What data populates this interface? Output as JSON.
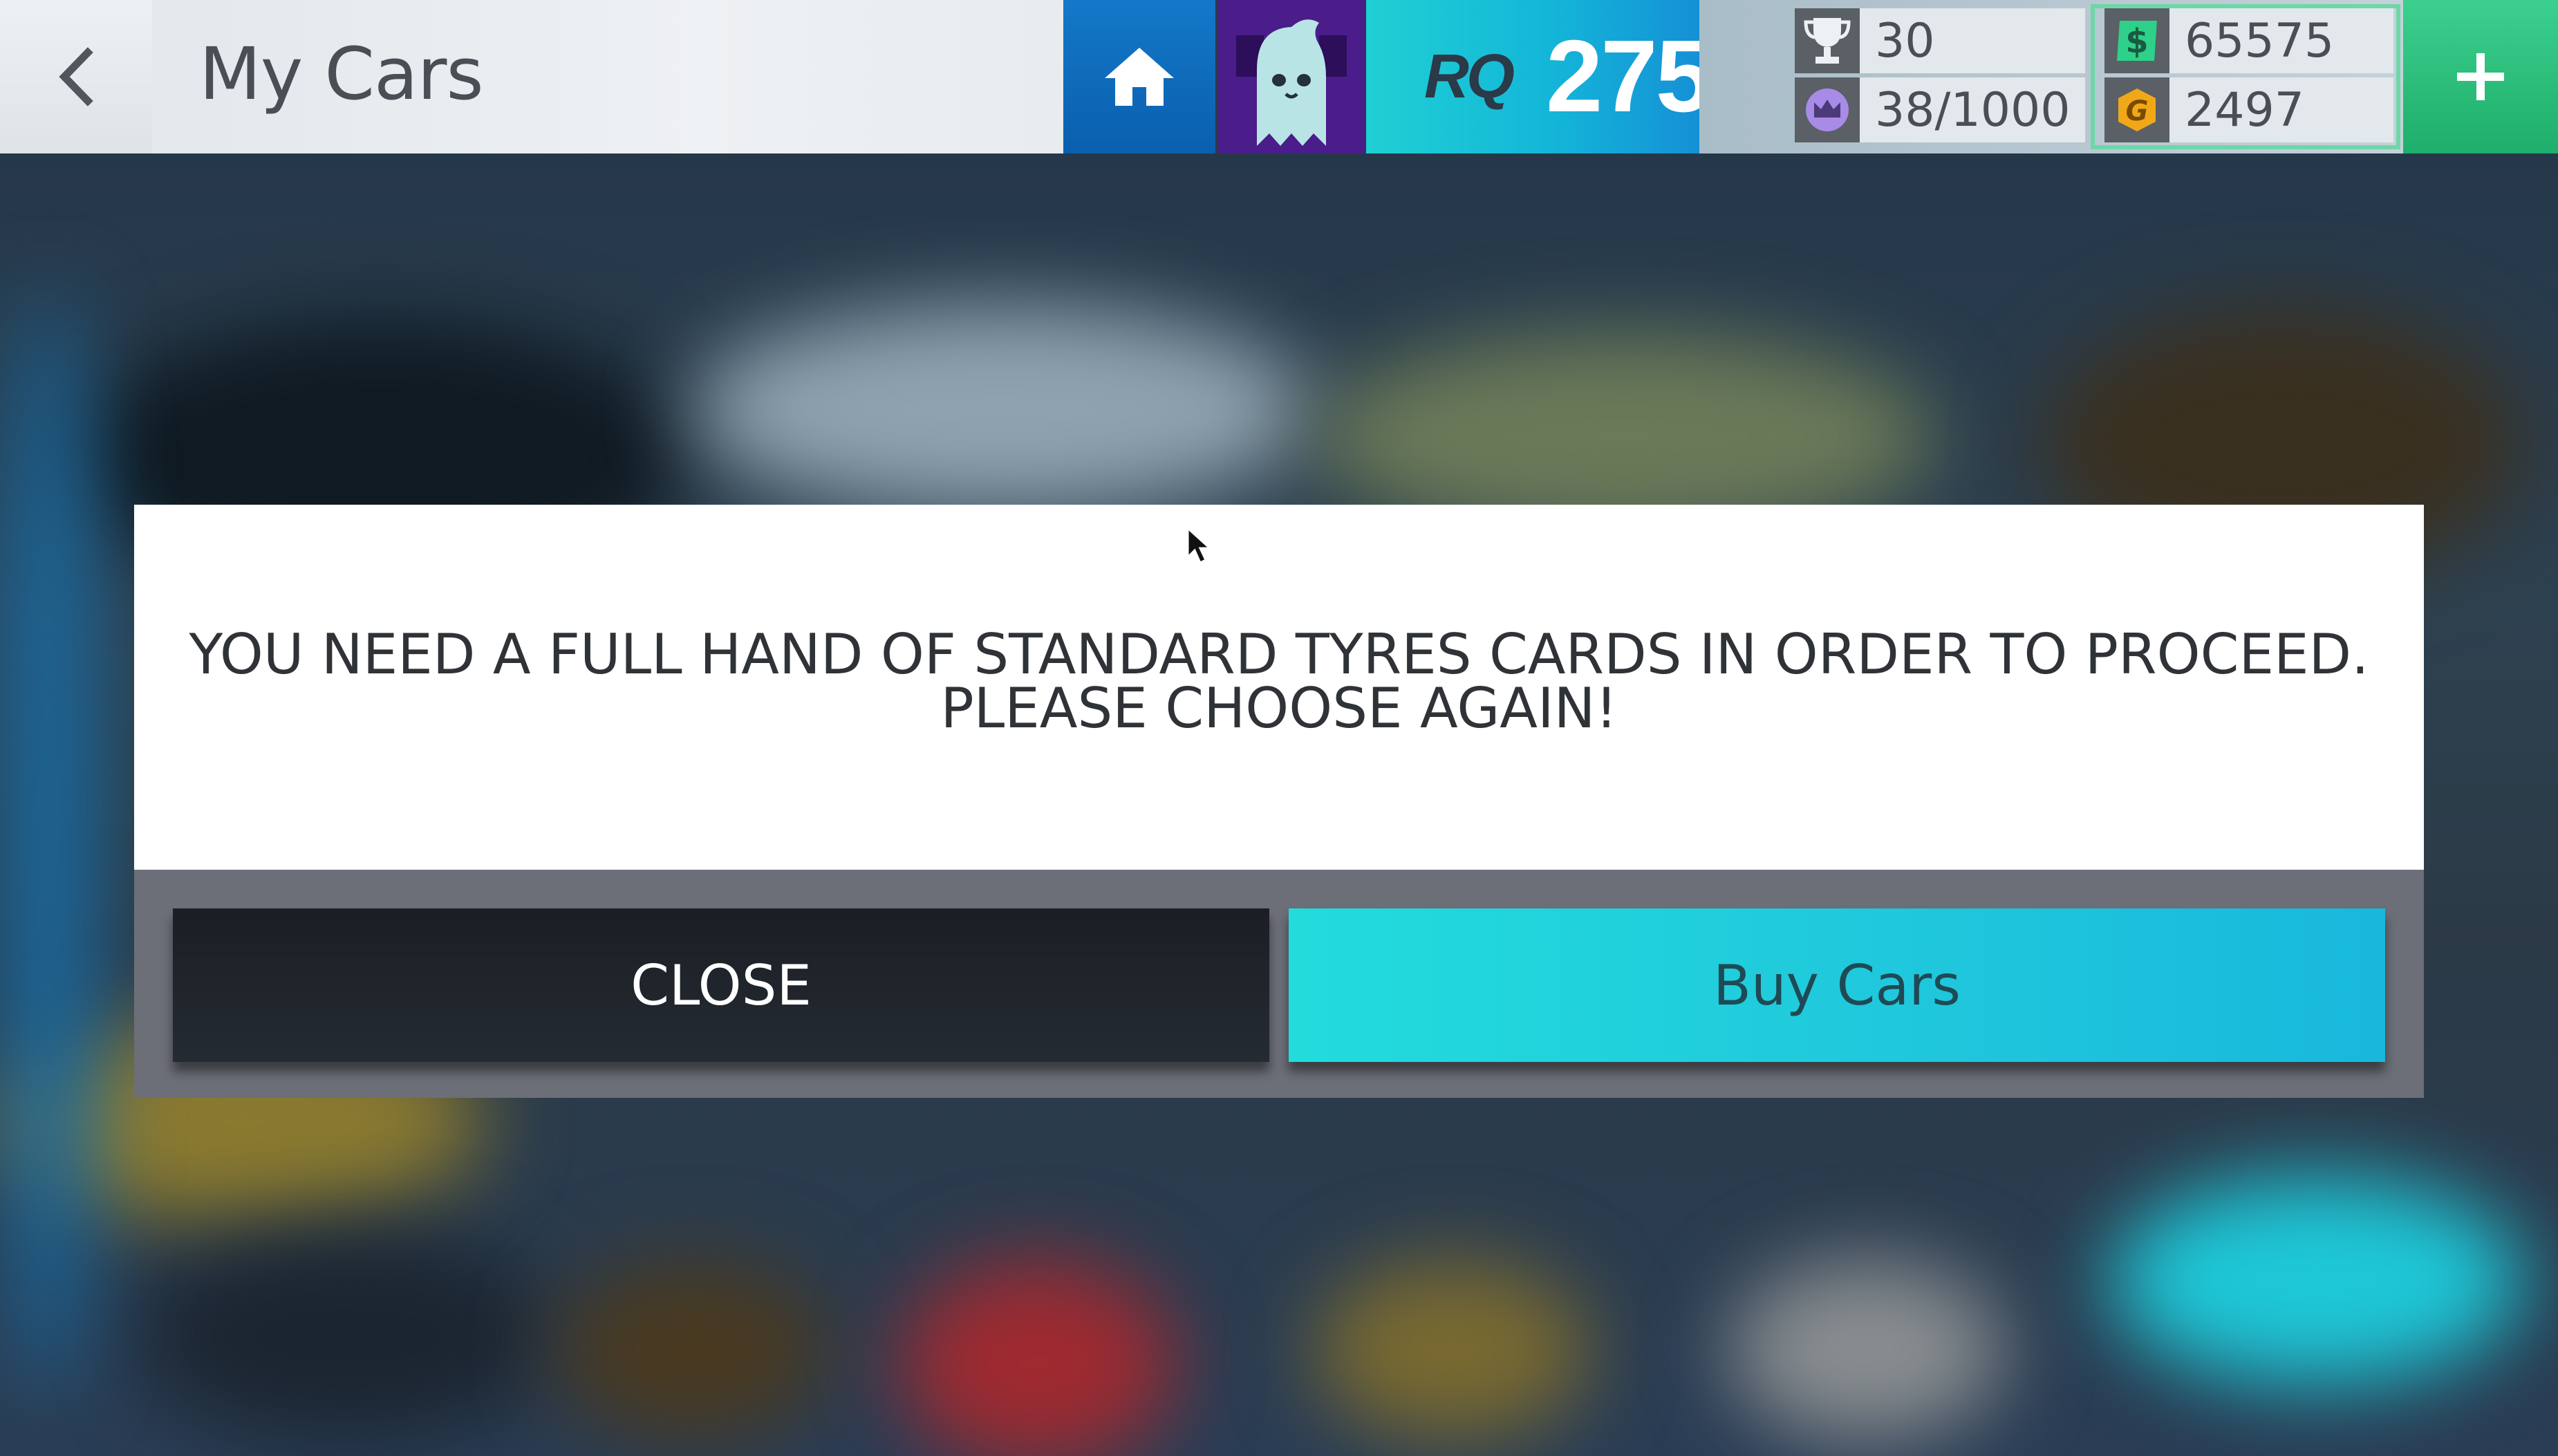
{
  "header": {
    "back_label": "Back",
    "title": "My Cars",
    "rq_logo": "RQ",
    "rq_value": "275",
    "trophies": "30",
    "prestige": "38/1000",
    "cash": "65575",
    "gold": "2497"
  },
  "dialog": {
    "message_line1": "YOU NEED A FULL HAND OF STANDARD TYRES CARDS IN ORDER TO PROCEED.",
    "message_line2": "PLEASE CHOOSE AGAIN!",
    "close_label": "CLOSE",
    "buy_label": "Buy Cars"
  },
  "icons": {
    "back": "chevron-left-icon",
    "home": "home-icon",
    "avatar": "ghost-avatar-icon",
    "trophy": "trophy-icon",
    "prestige": "crown-icon",
    "cash": "dollar-icon",
    "gold": "gold-coin-icon",
    "plus": "plus-icon"
  },
  "colors": {
    "accent_cyan": "#1fc6dc",
    "home_blue": "#0a5fae",
    "plus_green": "#1fae6b",
    "close_dark": "#1b1e24",
    "avatar_purple": "#4a1d8a"
  }
}
